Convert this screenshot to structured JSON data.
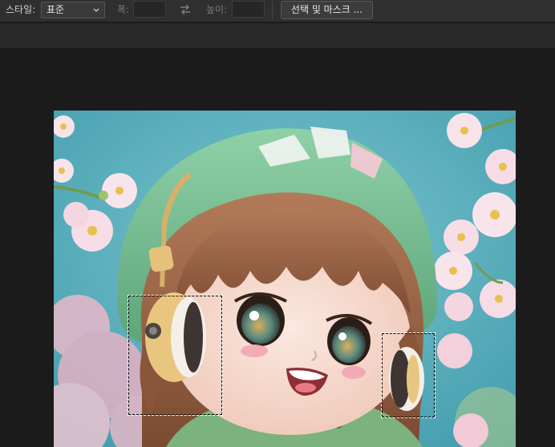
{
  "options_bar": {
    "style_label": "스타일:",
    "style_value": "표준",
    "width_label": "폭:",
    "width_value": "",
    "height_label": "높이:",
    "height_value": "",
    "select_and_mask_label": "선택 및 마스크 ..."
  },
  "icons": {
    "style_dropdown": "chevron-down-icon",
    "swap": "swap-arrows-icon"
  },
  "canvas": {
    "selections": 2,
    "colors": {
      "sky": "#57aebb",
      "hat": "#7bbf93",
      "hair": "#9a6445",
      "skin": "#f6ddd2",
      "headphones": "#e6c27c",
      "blossom": "#f6dde6"
    }
  }
}
